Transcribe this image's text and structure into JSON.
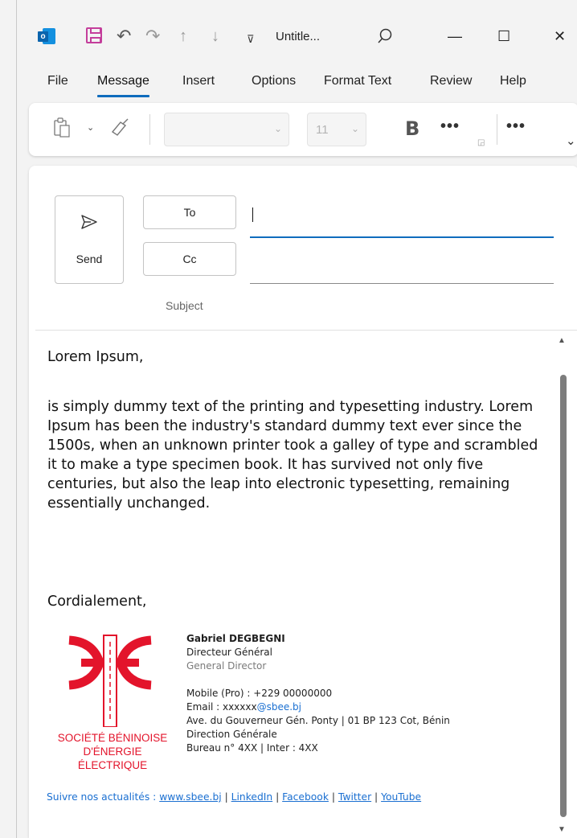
{
  "titlebar": {
    "app_icon": "outlook-icon",
    "app_letter": "o",
    "title": "Untitle...",
    "icons": [
      "save-icon",
      "undo-icon",
      "redo-icon",
      "up-arrow-icon",
      "down-arrow-icon",
      "customize-icon",
      "search-icon",
      "minimize-icon",
      "maximize-icon",
      "close-icon"
    ],
    "glyphs": {
      "undo": "↶",
      "redo": "↷",
      "up": "↑",
      "down": "↓",
      "customize": "⊽",
      "minimize": "—",
      "maximize": "☐",
      "close": "✕"
    }
  },
  "menu": {
    "items": [
      "File",
      "Message",
      "Insert",
      "Options",
      "Format Text",
      "Review",
      "Help"
    ],
    "active": "Message"
  },
  "ribbon": {
    "font_size": "11",
    "bold_label": "B",
    "more_label": "•••",
    "icons": [
      "paste-icon",
      "format-painter-icon",
      "dialog-launcher-icon",
      "chevron-down-icon"
    ]
  },
  "compose": {
    "send_label": "Send",
    "to_label": "To",
    "cc_label": "Cc",
    "subject_label": "Subject",
    "to_value": "",
    "cc_value": ""
  },
  "body": {
    "greeting": "Lorem Ipsum,",
    "paragraph": " is simply dummy text of the printing and typesetting industry. Lorem Ipsum has been the industry's standard dummy text ever since the 1500s, when an unknown printer took a galley of type and scrambled it to make a type specimen book. It has survived not only five centuries, but also the leap into electronic typesetting, remaining essentially unchanged.",
    "closing": "Cordialement,"
  },
  "signature": {
    "company_line1": "SOCIÉTÉ BÉNINOISE",
    "company_line2": "D'ÉNERGIE ÉLECTRIQUE",
    "name": "Gabriel DEGBEGNI",
    "title_fr": "Directeur Général",
    "title_en": "General Director",
    "mobile": "Mobile (Pro) : +229 00000000",
    "email_prefix": "Email : xxxxxx",
    "email_domain": "@sbee.bj",
    "address": "Ave. du Gouverneur Gén. Ponty | 01 BP 123 Cot, Bénin",
    "department": "Direction Générale",
    "office": "Bureau n° 4XX  | Inter : 4XX",
    "follow_label": "Suivre nos actualités : ",
    "links": [
      "www.sbee.bj",
      "LinkedIn",
      "Facebook",
      "Twitter",
      "YouTube"
    ],
    "link_separator": " | "
  },
  "colors": {
    "accent": "#0f6cbd",
    "brand_red": "#e3142b",
    "link": "#1a6fd1",
    "save_icon": "#c43e9b"
  }
}
